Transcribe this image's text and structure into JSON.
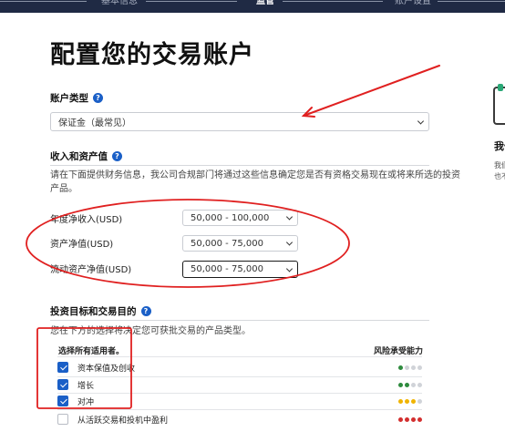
{
  "stepper": {
    "steps": [
      "基本信息",
      "监管",
      "账户设置"
    ],
    "active_index": 1
  },
  "page": {
    "title": "配置您的交易账户"
  },
  "account_type": {
    "label": "账户类型",
    "selected": "保证金（最常见）"
  },
  "income_assets": {
    "heading": "收入和资产值",
    "description_line1": "请在下面提供财务信息，我公司合规部门将通过这些信息确定您是否有资格交易现在或将来所选的投资",
    "description_line2": "产品。",
    "fields": [
      {
        "label": "年度净收入(USD)",
        "value": "50,000 - 100,000"
      },
      {
        "label": "资产净值(USD)",
        "value": "50,000 - 75,000"
      },
      {
        "label": "流动资产净值(USD)",
        "value": "50,000 - 75,000"
      }
    ]
  },
  "objectives": {
    "heading": "投资目标和交易目的",
    "description": "您在下方的选择将决定您可获批交易的产品类型。",
    "select_all_label": "选择所有适用者。",
    "risk_label": "风险承受能力",
    "items": [
      {
        "label": "资本保值及创收",
        "checked": true,
        "risk_dots": [
          "#2e8b3e",
          "#d0d3d8",
          "#d0d3d8",
          "#d0d3d8"
        ]
      },
      {
        "label": "增长",
        "checked": true,
        "risk_dots": [
          "#2e8b3e",
          "#2e8b3e",
          "#d0d3d8",
          "#d0d3d8"
        ]
      },
      {
        "label": "对冲",
        "checked": true,
        "risk_dots": [
          "#f0b400",
          "#f0b400",
          "#f0b400",
          "#d0d3d8"
        ]
      },
      {
        "label": "从活跃交易和投机中盈利",
        "checked": false,
        "risk_dots": [
          "#d32f2f",
          "#d32f2f",
          "#d32f2f",
          "#d32f2f"
        ]
      }
    ]
  },
  "side_panel": {
    "title": "我们",
    "line1": "我们",
    "line2": "也不"
  },
  "colors": {
    "accent": "#1a5fc7",
    "annotation": "#e02020",
    "header_bg": "#1f2a44"
  }
}
